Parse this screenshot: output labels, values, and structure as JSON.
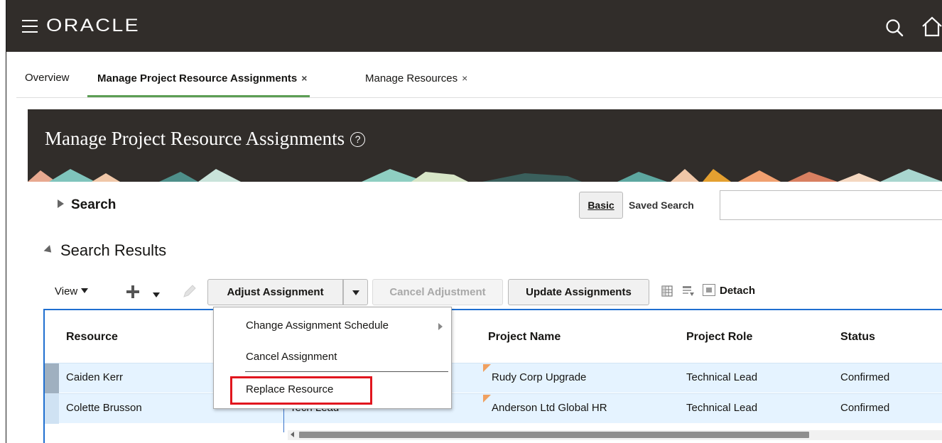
{
  "header": {
    "brand": "ORACLE"
  },
  "tabs": [
    {
      "label": "Overview",
      "closable": false
    },
    {
      "label": "Manage Project Resource Assignments",
      "closable": true,
      "active": true
    },
    {
      "label": "Manage Resources",
      "closable": true
    }
  ],
  "tab_close_glyph": "×",
  "page": {
    "title": "Manage Project Resource Assignments",
    "help_glyph": "?"
  },
  "search": {
    "label": "Search",
    "basic_button": "Basic",
    "saved_search_label": "Saved Search",
    "saved_search_value": ""
  },
  "results": {
    "title": "Search Results"
  },
  "toolbar": {
    "view_label": "View",
    "adjust_assignment": "Adjust Assignment",
    "cancel_adjustment": "Cancel Adjustment",
    "update_assignments": "Update Assignments",
    "detach": "Detach"
  },
  "menu": {
    "items": [
      "Change Assignment Schedule",
      "Cancel Assignment",
      "Replace Resource"
    ]
  },
  "table": {
    "columns": [
      "Resource",
      "Project Name",
      "Project Role",
      "Status"
    ],
    "rows": [
      {
        "resource": "Caiden Kerr",
        "request_role": "",
        "project_name": "Rudy Corp Upgrade",
        "project_role": "Technical Lead",
        "status": "Confirmed"
      },
      {
        "resource": "Colette Brusson",
        "request_role": "Tech Lead",
        "project_name": "Anderson Ltd Global HR",
        "project_role": "Technical Lead",
        "status": "Confirmed"
      }
    ]
  },
  "colors": {
    "topbar": "#312d2a",
    "active_tab_underline": "#5c9e54",
    "table_border": "#1f6fd0",
    "selected_row": "#e5f3ff",
    "highlight": "#e1161e"
  },
  "icons": [
    "hamburger-icon",
    "search-icon",
    "home-icon",
    "help-icon",
    "plus-icon",
    "pencil-icon",
    "freeze-icon",
    "wrap-icon",
    "detach-icon",
    "submenu-arrow-icon"
  ]
}
